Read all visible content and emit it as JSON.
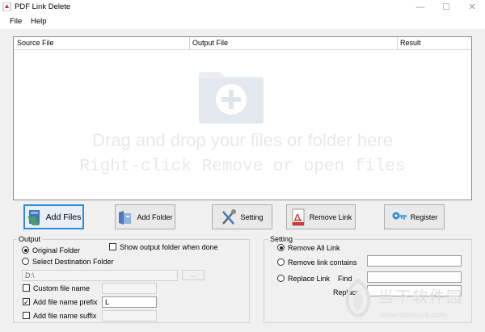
{
  "window": {
    "title": "PDF Link Delete",
    "controls": {
      "minimize": "—",
      "maximize": "☐",
      "close": "✕"
    }
  },
  "menu": {
    "file": "File",
    "help": "Help"
  },
  "table": {
    "columns": [
      "Source File",
      "Output File",
      "Result"
    ],
    "drop_hint_1": "Drag and drop your files or folder here",
    "drop_hint_2": "Right-click Remove or open files"
  },
  "toolbar": {
    "add_files": "Add Files",
    "add_folder": "Add Folder",
    "setting": "Setting",
    "remove_link": "Remove Link",
    "register": "Register"
  },
  "output": {
    "title": "Output",
    "original_folder": "Original Folder",
    "select_destination": "Select Destination Folder",
    "show_output_folder": "Show output folder when done",
    "path_value": "D:\\",
    "browse": "...",
    "custom_file_name": "Custom file name",
    "add_prefix": "Add file name prefix",
    "prefix_value": "L",
    "add_suffix": "Add file name suffix"
  },
  "setting": {
    "title": "Setting",
    "remove_all_link": "Remove All Link",
    "remove_link_contains": "Remove link contains",
    "replace_link": "Replace Link",
    "find": "Find",
    "replace": "Replace"
  },
  "watermark": {
    "brand": "当下软件园",
    "url": "www.downxia.com"
  },
  "state": {
    "output_mode": "Original Folder",
    "show_output_folder": false,
    "custom_file_name": false,
    "add_prefix": true,
    "add_suffix": false,
    "setting_mode": "Remove All Link"
  },
  "colors": {
    "accent": "#2f8ad6",
    "pdf_red": "#d9342b",
    "folder_grey": "#e9edf3"
  }
}
